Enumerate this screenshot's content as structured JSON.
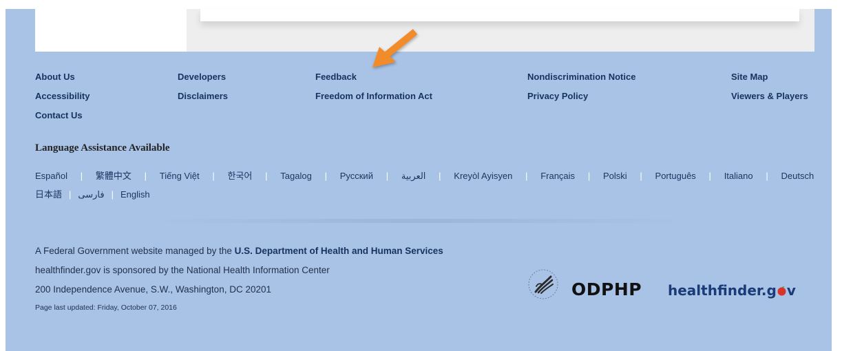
{
  "footer_links": {
    "about_us": "About Us",
    "accessibility": "Accessibility",
    "contact_us": "Contact Us",
    "developers": "Developers",
    "disclaimers": "Disclaimers",
    "feedback": "Feedback",
    "foia": "Freedom of Information Act",
    "nondiscrimination": "Nondiscrimination Notice",
    "privacy": "Privacy Policy",
    "site_map": "Site Map",
    "viewers_players": "Viewers & Players"
  },
  "language": {
    "heading": "Language Assistance Available",
    "row1": [
      "Español",
      "繁體中文",
      "Tiếng Việt",
      "한국어",
      "Tagalog",
      "Русский",
      "العربية",
      "Kreyòl Ayisyen",
      "Français",
      "Polski",
      "Português",
      "Italiano",
      "Deutsch"
    ],
    "row2": [
      "日本語",
      "فارسی",
      "English"
    ],
    "separator": "|"
  },
  "info": {
    "managed_prefix": "A Federal Government website managed by the ",
    "hhs_link": "U.S. Department of Health and Human Services",
    "sponsor": "healthfinder.gov is sponsored by the National Health Information Center",
    "address": "200 Independence Avenue, S.W., Washington, DC 20201",
    "updated": "Page last updated: Friday, October 07, 2016"
  },
  "logos": {
    "odphp": "ODPHP",
    "healthfinder_prefix": "healthfinder.g",
    "healthfinder_suffix": "v"
  },
  "colors": {
    "footer_bg": "#a9c3e6",
    "link": "#17325e",
    "annotation_arrow": "#f28c2b"
  },
  "icons": {
    "seal": "hhs-eagle-seal-icon",
    "arrow": "annotation-arrow-icon",
    "apple": "apple-icon"
  }
}
